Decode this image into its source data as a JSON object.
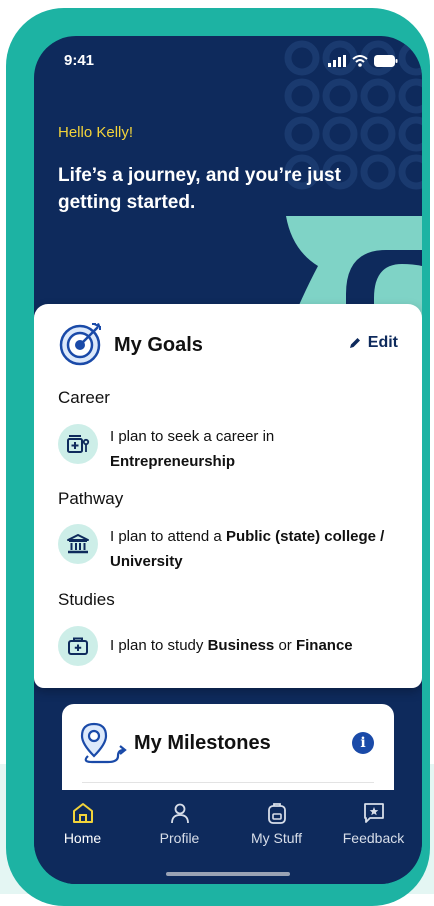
{
  "status_bar": {
    "time": "9:41"
  },
  "header": {
    "greeting": "Hello Kelly!",
    "tagline": "Life’s a journey, and you’re just getting started."
  },
  "goals": {
    "title": "My Goals",
    "edit_label": "Edit",
    "sections": [
      {
        "title": "Career",
        "icon": "calculator-icon",
        "text_before": "I plan to seek a career in",
        "bold1": "Entrepreneurship",
        "text_mid": "",
        "bold2": ""
      },
      {
        "title": "Pathway",
        "icon": "university-icon",
        "text_before": "I plan to attend a",
        "bold1": "Public (state) college / University",
        "text_mid": "",
        "bold2": ""
      },
      {
        "title": "Studies",
        "icon": "briefcase-icon",
        "text_before": "I plan to study",
        "bold1": "Business",
        "text_mid": "or",
        "bold2": "Finance"
      }
    ]
  },
  "milestones": {
    "title": "My Milestones"
  },
  "tabs": [
    {
      "label": "Home",
      "icon": "home-icon",
      "active": true
    },
    {
      "label": "Profile",
      "icon": "person-icon",
      "active": false
    },
    {
      "label": "My Stuff",
      "icon": "backpack-icon",
      "active": false
    },
    {
      "label": "Feedback",
      "icon": "feedback-icon",
      "active": false
    }
  ],
  "colors": {
    "navy": "#0e2a5c",
    "teal": "#1db3a3",
    "greeting_yellow": "#f2d33a",
    "icon_bg": "#cdeee8",
    "info_blue": "#1a4aa8"
  }
}
